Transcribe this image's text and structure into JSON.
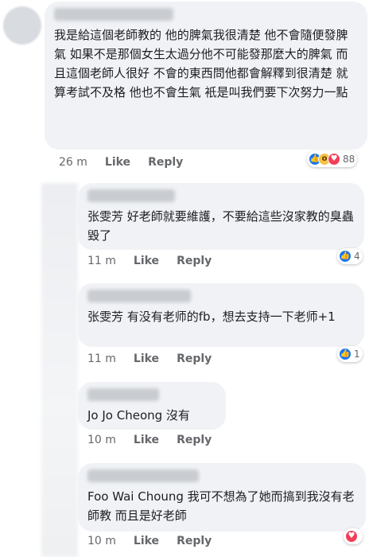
{
  "comments": [
    {
      "text": "我是給這個老師教的 他的脾氣我很清楚 他不會隨便發脾氣 如果不是那個女生太過分他不可能發那麼大的脾氣 而且這個老師人很好 不會的東西問他都會解釋到很清楚 就算考試不及格 他也不會生氣 衹是叫我們要下次努力一點",
      "time": "26 m",
      "like": "Like",
      "reply": "Reply",
      "reactions": [
        "like-icon",
        "wow-icon",
        "love-icon"
      ],
      "reaction_count": "88"
    }
  ],
  "replies": [
    {
      "text": "张雯芳 好老師就要維護，不要給這些沒家教的臭蟲毀了",
      "time": "11 m",
      "like": "Like",
      "reply": "Reply",
      "reactions": [
        "like-icon"
      ],
      "reaction_count": "4"
    },
    {
      "text": "张雯芳 有没有老师的fb，想去支持一下老师+1",
      "time": "11 m",
      "like": "Like",
      "reply": "Reply",
      "reactions": [
        "like-icon"
      ],
      "reaction_count": "1"
    },
    {
      "text": "Jo Jo Cheong 沒有",
      "time": "10 m",
      "like": "Like",
      "reply": "Reply"
    },
    {
      "text": "Foo Wai Choung 我可不想為了她而搞到我沒有老師教 而且是好老師",
      "time": "10 m",
      "like": "Like",
      "reply": "Reply",
      "reactions": [
        "love-icon"
      ],
      "reaction_count": ""
    }
  ],
  "colors": {
    "bubble": "#f0f2f5",
    "meta": "#65676b",
    "like": "#1877f2",
    "love": "#f33e58",
    "wow": "#f7c244"
  }
}
